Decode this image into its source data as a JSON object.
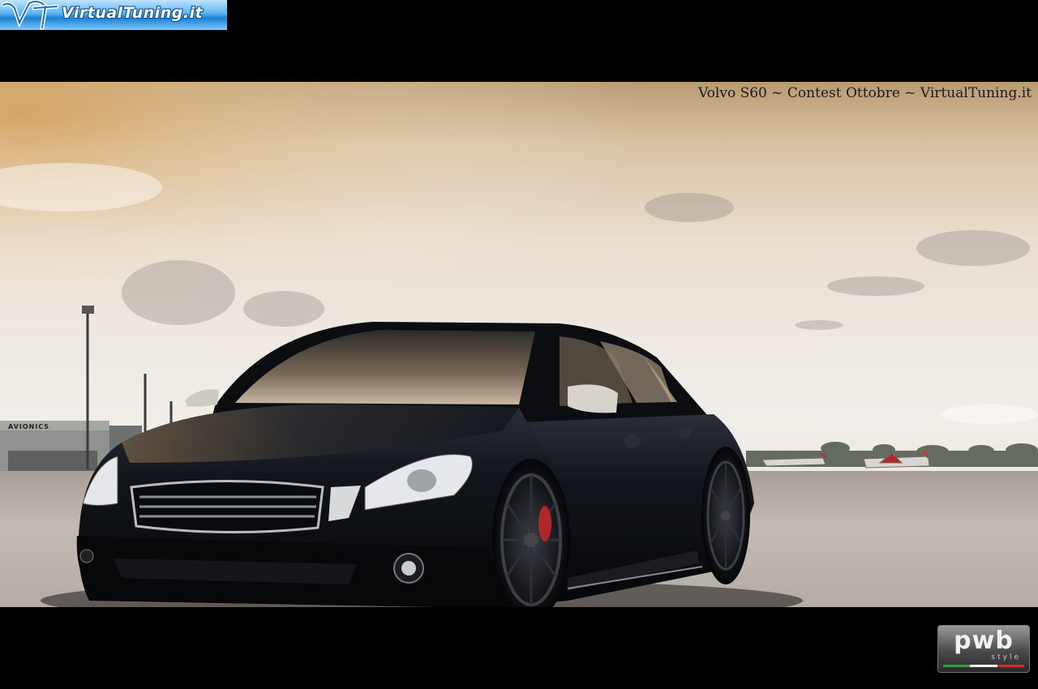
{
  "site_logo": {
    "text": "VirtualTuning.it",
    "icon": "vt-logo-icon"
  },
  "caption": "Volvo S60  ~  Contest Ottobre  ~  VirtualTuning.it",
  "hangar_sign": "AVIONICS",
  "watermark": {
    "text": "pwb",
    "subtext": "style",
    "colors": [
      "#2e9e3e",
      "#f2f2f2",
      "#d22b2b"
    ]
  },
  "palette": {
    "background": "#000000",
    "sky_top": "#b89b73",
    "sky_mid": "#efe9e3",
    "tarmac": "#b9b2ab",
    "car_body": "#0d0f14"
  }
}
